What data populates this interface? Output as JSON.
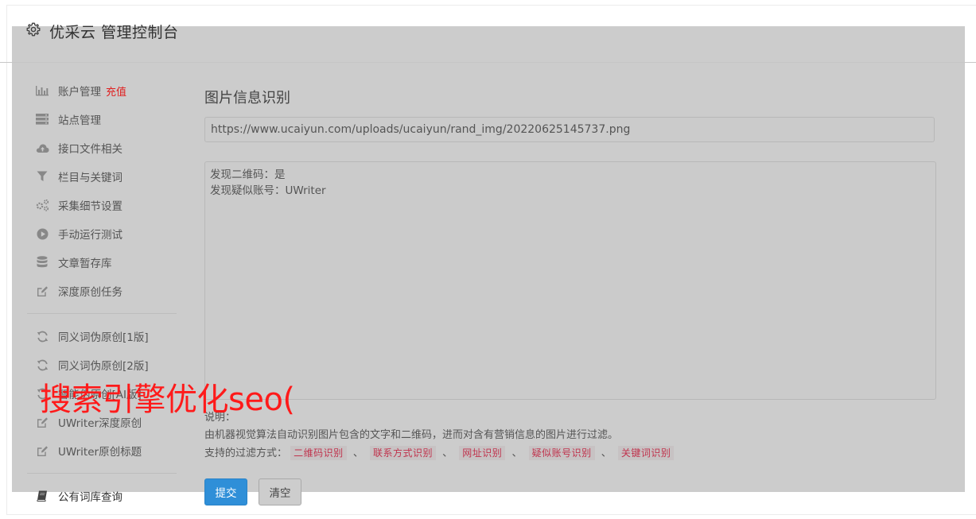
{
  "header": {
    "title": "优采云 管理控制台",
    "icon": "gear-icon"
  },
  "sidebar": {
    "group1": [
      {
        "label": "账户管理",
        "badge": "充值",
        "icon": "bar-chart-icon"
      },
      {
        "label": "站点管理",
        "icon": "server-icon"
      },
      {
        "label": "接口文件相关",
        "icon": "cloud-upload-icon"
      },
      {
        "label": "栏目与关键词",
        "icon": "filter-icon"
      },
      {
        "label": "采集细节设置",
        "icon": "cogs-icon"
      },
      {
        "label": "手动运行测试",
        "icon": "play-circle-icon"
      },
      {
        "label": "文章暂存库",
        "icon": "database-icon"
      },
      {
        "label": "深度原创任务",
        "icon": "edit-icon"
      }
    ],
    "group2": [
      {
        "label": "同义词伪原创[1版]",
        "icon": "refresh-icon"
      },
      {
        "label": "同义词伪原创[2版]",
        "icon": "refresh-icon"
      },
      {
        "label": "智能伪原创[AI版]",
        "icon": "refresh-icon"
      },
      {
        "label": "UWriter深度原创",
        "icon": "edit-icon"
      },
      {
        "label": "UWriter原创标题",
        "icon": "edit-icon"
      }
    ],
    "group3": [
      {
        "label": "公有词库查询",
        "icon": "book-icon"
      }
    ]
  },
  "main": {
    "title": "图片信息识别",
    "url_value": "https://www.ucaiyun.com/uploads/ucaiyun/rand_img/20220625145737.png",
    "result_lines": [
      "发现二维码：是",
      "发现疑似账号：UWriter"
    ],
    "desc_label": "说明：",
    "desc_text": "由机器视觉算法自动识别图片包含的文字和二维码，进而对含有营销信息的图片进行过滤。",
    "filter_label": "支持的过滤方式：",
    "filters": [
      "二维码识别",
      "联系方式识别",
      "网址识别",
      "疑似账号识别",
      "关键词识别"
    ],
    "filter_separator": "、",
    "submit_label": "提交",
    "clear_label": "清空"
  },
  "watermark": "搜索引擎优化seo(",
  "colors": {
    "accent": "#2f8fd8",
    "badge": "#e02020",
    "tag_text": "#c0334d",
    "watermark": "#ff1a1a"
  }
}
